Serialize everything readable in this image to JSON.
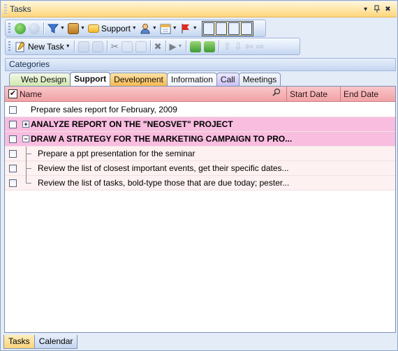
{
  "window": {
    "title": "Tasks",
    "controls": [
      "▾",
      "✖"
    ],
    "pin": "📌"
  },
  "toolbar1": {
    "support_label": "Support"
  },
  "toolbar2": {
    "new_task_label": "New Task"
  },
  "categories_label": "Categories",
  "category_tabs": [
    {
      "label": "Web Design"
    },
    {
      "label": "Support"
    },
    {
      "label": "Development"
    },
    {
      "label": "Information"
    },
    {
      "label": "Call"
    },
    {
      "label": "Meetings"
    }
  ],
  "grid": {
    "columns": {
      "name": "Name",
      "start_date": "Start Date",
      "end_date": "End Date"
    },
    "rows": [
      {
        "text": "Prepare sales report for February, 2009"
      },
      {
        "text": "ANALYZE REPORT ON THE \"NEOSVET\" PROJECT",
        "expander": "+"
      },
      {
        "text": "DRAW A STRATEGY FOR THE MARKETING CAMPAIGN TO PRO...",
        "expander": "−"
      },
      {
        "text": "Prepare a ppt presentation for the seminar"
      },
      {
        "text": "Review the list of closest important events, get their specific dates..."
      },
      {
        "text": "Review the list of tasks, bold-type those that are due today; pester..."
      }
    ]
  },
  "bottom_tabs": [
    {
      "label": "Tasks"
    },
    {
      "label": "Calendar"
    }
  ]
}
